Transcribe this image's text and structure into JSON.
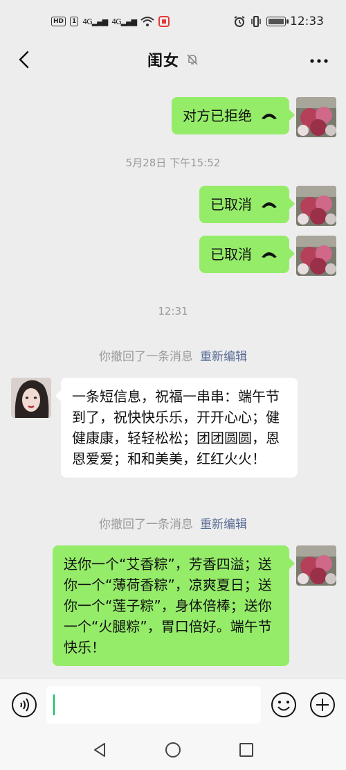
{
  "status_bar": {
    "hd": "HD",
    "sim": "1",
    "net1": "4G",
    "net2": "4G",
    "time": "12:33"
  },
  "header": {
    "title": "闺女",
    "icons": [
      "back-chevron",
      "mute-bell",
      "more-dots"
    ]
  },
  "messages": {
    "call_refused": "对方已拒绝",
    "time1": "5月28日 下午15:52",
    "call_cancel1": "已取消",
    "call_cancel2": "已取消",
    "time2": "12:31",
    "recall1_text": "你撤回了一条消息",
    "recall1_edit": "重新编辑",
    "incoming_text": "一条短信息，祝福一串串：端午节到了，祝快快乐乐，开开心心；健健康康，轻轻松松；团团圆圆，恩恩爱爱；和和美美，红红火火！",
    "recall2_text": "你撤回了一条消息",
    "recall2_edit": "重新编辑",
    "outgoing_text": "送你一个“艾香粽”，芳香四溢；送你一个“薄荷香粽”，凉爽夏日；送你一个“莲子粽”，身体倍棒；送你一个“火腿粽”，胃口倍好。端午节快乐！"
  },
  "colors": {
    "bubble_green": "#95ec69",
    "link_blue": "#576b95",
    "cursor_green": "#07c160"
  },
  "input": {
    "value": ""
  }
}
